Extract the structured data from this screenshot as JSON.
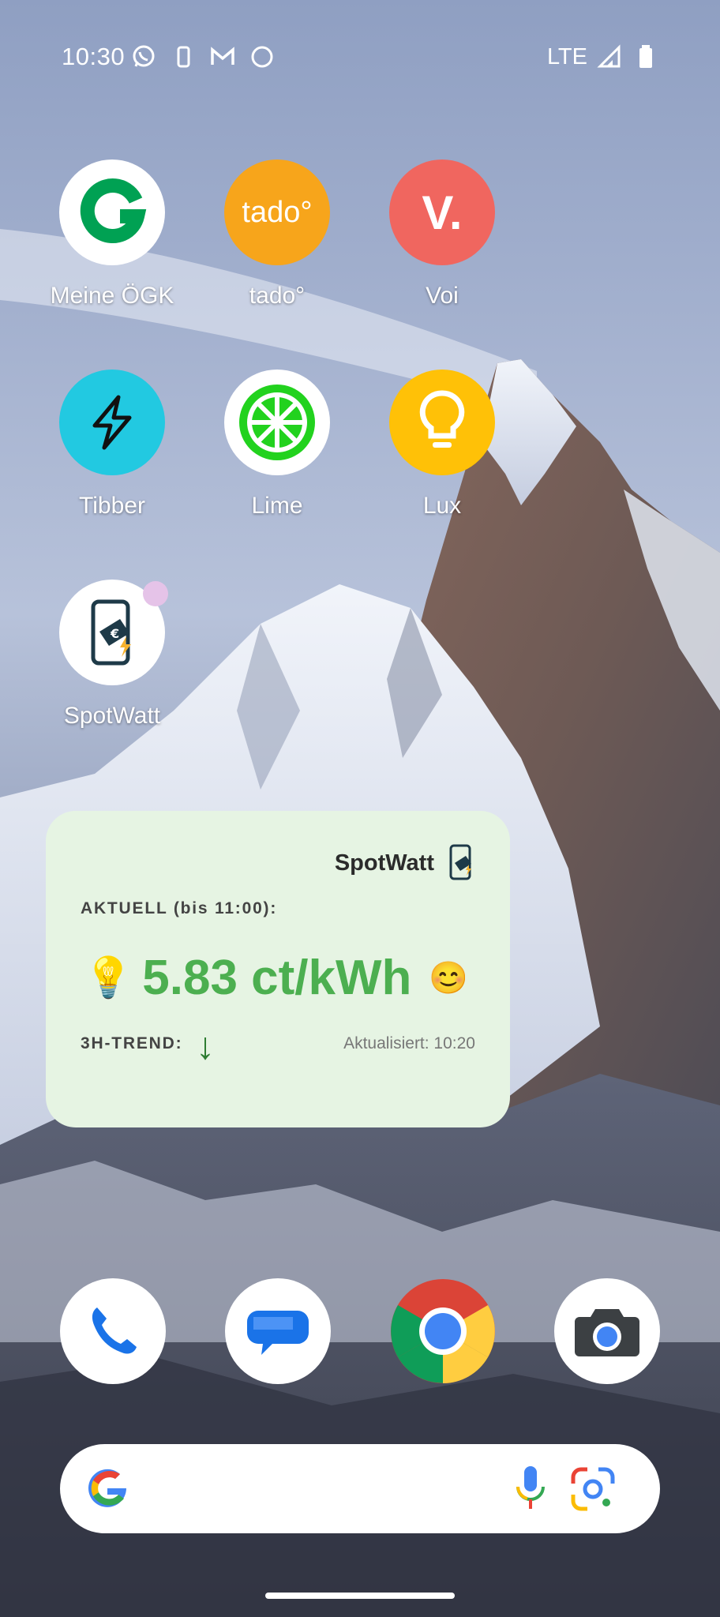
{
  "status_bar": {
    "time": "10:30",
    "network": "LTE",
    "left_icons": [
      "whatsapp-icon",
      "phone-device-icon",
      "gmail-icon",
      "circle-icon"
    ],
    "right_icons": [
      "signal-icon",
      "battery-icon"
    ]
  },
  "apps": [
    {
      "label": "Meine ÖGK",
      "icon": "oegk-icon",
      "color": "#ffffff"
    },
    {
      "label": "tado°",
      "icon": "tado-icon",
      "icon_text": "tado°",
      "color": "#f7a51b"
    },
    {
      "label": "Voi",
      "icon": "voi-icon",
      "icon_text": "V.",
      "color": "#f0665f"
    },
    {
      "label": "Tibber",
      "icon": "tibber-icon",
      "color": "#22c9e1"
    },
    {
      "label": "Lime",
      "icon": "lime-icon",
      "color": "#ffffff"
    },
    {
      "label": "Lux",
      "icon": "lux-icon",
      "color": "#ffc107"
    },
    {
      "label": "SpotWatt",
      "icon": "spotwatt-icon",
      "color": "#ffffff",
      "has_notification": true
    }
  ],
  "widget": {
    "brand": "SpotWatt",
    "current_label": "AKTUELL (bis 11:00):",
    "price": "5.83 ct/kWh",
    "bulb": "💡",
    "mood": "😊",
    "trend_label": "3H-TREND:",
    "trend_arrow": "↓",
    "updated": "Aktualisiert: 10:20",
    "price_color": "#4caf50"
  },
  "dock": [
    "phone-icon",
    "messages-icon",
    "chrome-icon",
    "camera-icon"
  ],
  "search": {
    "icons": [
      "google-g-icon",
      "microphone-icon",
      "lens-icon"
    ]
  }
}
